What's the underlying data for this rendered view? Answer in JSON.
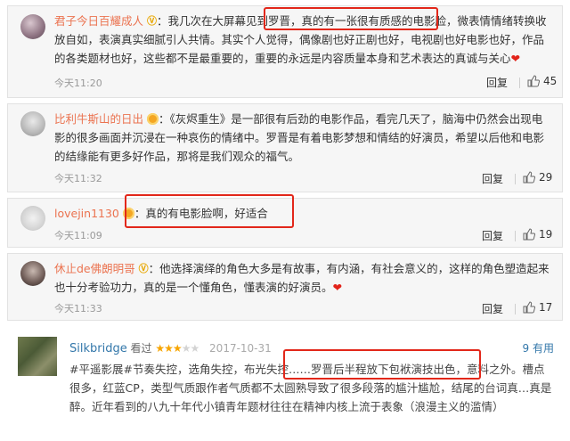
{
  "comments": [
    {
      "username": "君子今日百耀成人",
      "badge": "V",
      "text_before": "：我几次在大屏幕见到罗晋，",
      "text_highlight": "真的有一张很有质感的电影脸",
      "text_after": "，微表情情绪转换收放自如，表演真实细腻引人共情。其实个人觉得，偶像剧也好正剧也好，电视剧也好电影也好，作品的各类题材也好，这些都不是最重要的，重要的永远是内容质量本身和艺术表达的真诚与关心",
      "emoji": "heart-icon",
      "time": "今天11:20",
      "reply_label": "回复",
      "likes": "45"
    },
    {
      "username": "比利牛斯山的日出",
      "badge": "crown",
      "text": "：《灰烬重生》是一部很有后劲的电影作品，看完几天了，脑海中仍然会出现电影的很多画面并沉浸在一种哀伤的情绪中。罗晋是有着电影梦想和情结的好演员，希望以后他和电影的结缘能有更多好作品，那将是我们观众的福气。",
      "time": "今天11:32",
      "reply_label": "回复",
      "likes": "29"
    },
    {
      "username": "lovejin1130",
      "badge": "crown",
      "text": "：真的有电影脸啊，好适合",
      "time": "今天11:09",
      "reply_label": "回复",
      "likes": "19"
    },
    {
      "username": "休止de佛朗明哥",
      "badge": "V",
      "text": "：他选择演绎的角色大多是有故事，有内涵，有社会意义的，这样的角色塑造起来也十分考验功力，真的是一个懂角色，懂表演的好演员。",
      "emoji": "heart-icon",
      "time": "今天11:33",
      "reply_label": "回复",
      "likes": "17"
    }
  ],
  "review": {
    "username": "Silkbridge",
    "status": "看过",
    "rating_stars": 3,
    "rating_max": 5,
    "date": "2017-10-31",
    "useful_count": "9",
    "useful_label": "有用",
    "text_before": "#平遥影展#节奏失控，选角失控，布光失控……",
    "text_highlight": "罗晋后半程放下包袱演技出色，意料之外",
    "text_after": "。槽点很多，红蓝CP，类型气质跟作者气质都不太圆熟导致了很多段落的尴汁尴尬，结尾的台词真…真是醉。近年看到的八九十年代小镇青年题材往往在精神内核上流于表象（浪漫主义的滥情）"
  },
  "colors": {
    "username": "#eb7350",
    "highlight_box": "#e2271a",
    "review_link": "#3377aa",
    "star": "#f7a500"
  }
}
